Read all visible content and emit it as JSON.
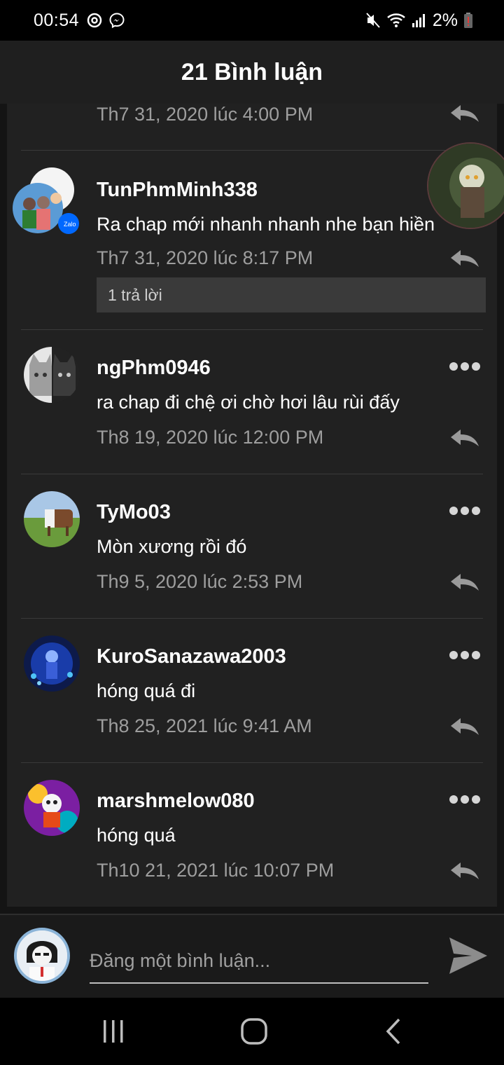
{
  "status_bar": {
    "time": "00:54",
    "battery_percent": "2%"
  },
  "header": {
    "title": "21 Bình luận"
  },
  "comments": [
    {
      "date": "Th7 31, 2020 lúc 4:00 PM"
    },
    {
      "username": "TunPhmMinh338",
      "text": "Ra chap mới nhanh nhanh nhe bạn hiền",
      "date": "Th7 31, 2020 lúc 8:17 PM",
      "replies_label": "1 trả lời"
    },
    {
      "username": "ngPhm0946",
      "text": "ra chap đi chệ ơi chờ hơi lâu rùi đấy",
      "date": "Th8 19, 2020 lúc 12:00 PM"
    },
    {
      "username": "TyMo03",
      "text": "Mòn xương rồi đó",
      "date": "Th9 5, 2020 lúc 2:53 PM"
    },
    {
      "username": "KuroSanazawa2003",
      "text": "hóng quá đi",
      "date": "Th8 25, 2021 lúc 9:41 AM"
    },
    {
      "username": "marshmelow080",
      "text": "hóng quá",
      "date": "Th10 21, 2021 lúc 10:07 PM"
    }
  ],
  "composer": {
    "placeholder": "Đăng một bình luận..."
  },
  "colors": {
    "background": "#141414",
    "list_background": "#212121",
    "header_background": "#1f1f1f",
    "secondary_text": "#9e9e9e",
    "replies_background": "#3a3a3a"
  },
  "icons": {
    "status_left": [
      "sync-icon",
      "messenger-icon"
    ],
    "status_right": [
      "mute-icon",
      "wifi-icon",
      "signal-icon",
      "battery-low-icon"
    ],
    "comment_actions": [
      "reply-icon",
      "more-options-icon"
    ],
    "composer": [
      "send-icon"
    ],
    "navigation": [
      "recents-icon",
      "home-icon",
      "back-icon"
    ]
  }
}
